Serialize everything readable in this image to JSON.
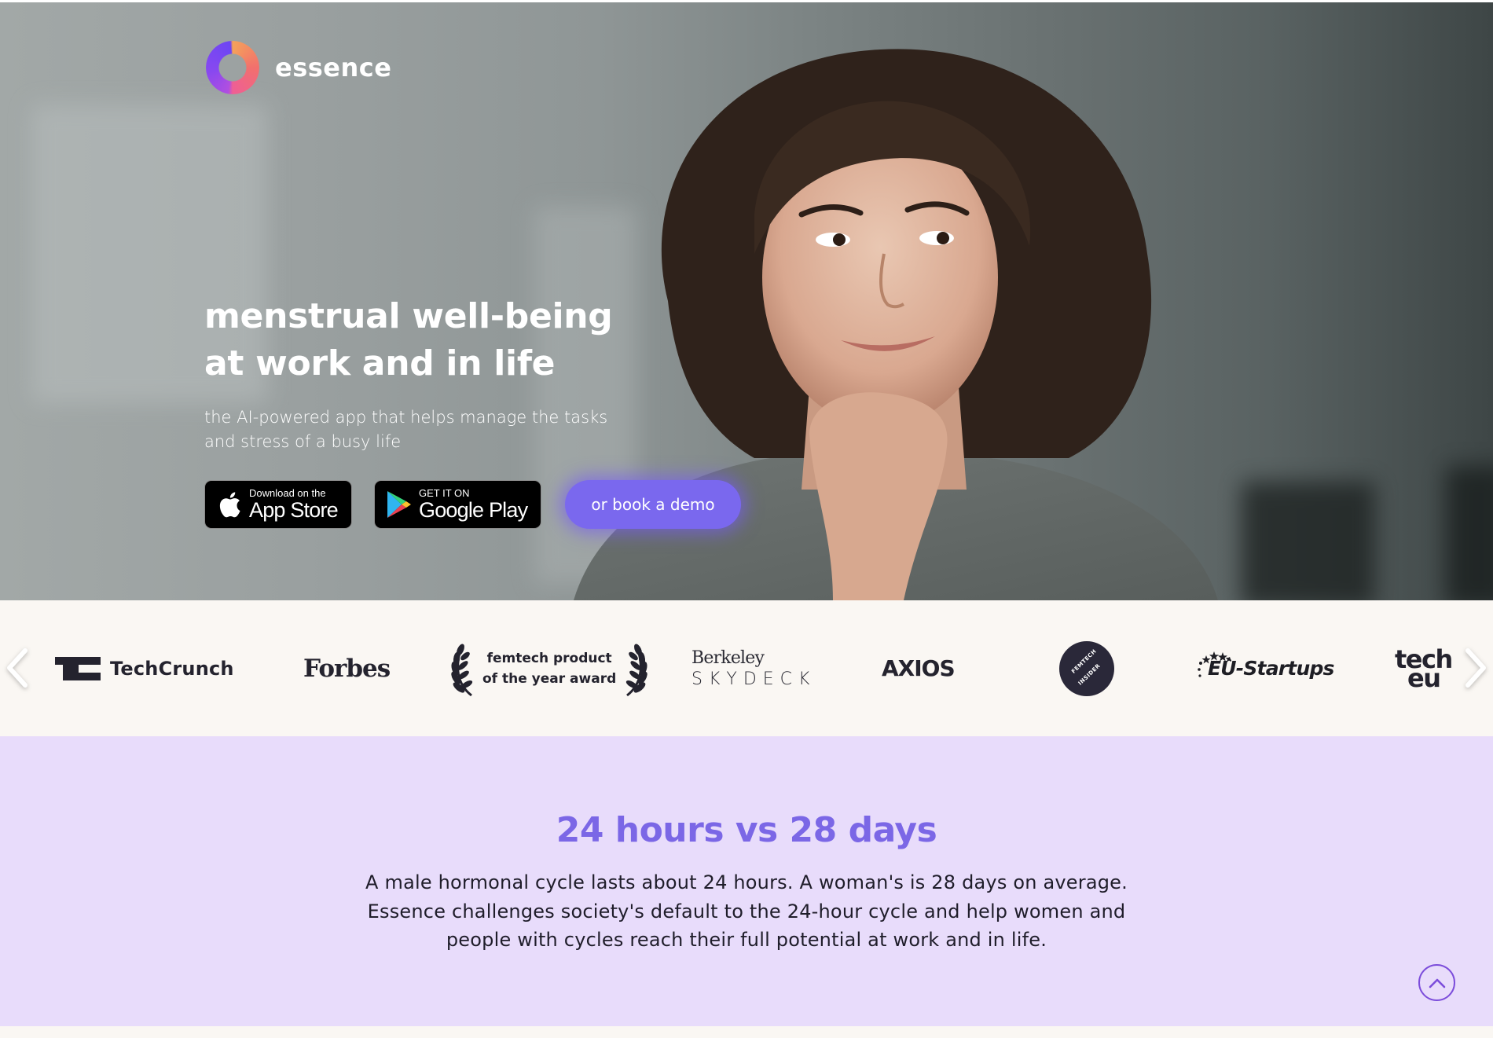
{
  "brand": {
    "name": "essence",
    "logo_icon": "ring-gradient-logo",
    "colors": {
      "accent": "#7a68ee",
      "heading_purple": "#7b67e6",
      "section_bg": "#e8dcfb",
      "strip_bg": "#faf7f3"
    }
  },
  "hero": {
    "headline_line1": "menstrual well-being",
    "headline_line2": "at work and in life",
    "subtitle_line1": "the AI-powered app that helps manage the tasks",
    "subtitle_line2": "and stress of a busy life",
    "app_store": {
      "small": "Download on the",
      "big": "App Store",
      "icon": "apple-icon"
    },
    "google_play": {
      "small": "GET IT ON",
      "big": "Google Play",
      "icon": "google-play-icon"
    },
    "demo_button": "or book a demo"
  },
  "press": {
    "logos": [
      {
        "name": "TechCrunch",
        "mark": "TC"
      },
      {
        "name": "Forbes"
      },
      {
        "name": "femtech product of the year award",
        "line1": "femtech product",
        "line2": "of the year award"
      },
      {
        "name": "Berkeley SkyDeck",
        "line1": "Berkeley",
        "line2": "SKYDECK"
      },
      {
        "name": "AXIOS"
      },
      {
        "name": "Femtech Insider",
        "line1": "FEMTECH",
        "line2": "INSIDER"
      },
      {
        "name": "EU-Startups"
      },
      {
        "name": "tech.eu",
        "line1": "tech",
        "line2": "eu"
      }
    ],
    "prev_icon": "chevron-left-icon",
    "next_icon": "chevron-right-icon"
  },
  "cycle_section": {
    "title": "24 hours vs 28 days",
    "body": "A male hormonal cycle lasts about 24 hours. A woman's is 28 days on average. Essence challenges society's default to the 24-hour cycle and help women and people with cycles reach their full potential at work and in life."
  },
  "scroll_top": {
    "icon": "chevron-up-icon"
  }
}
